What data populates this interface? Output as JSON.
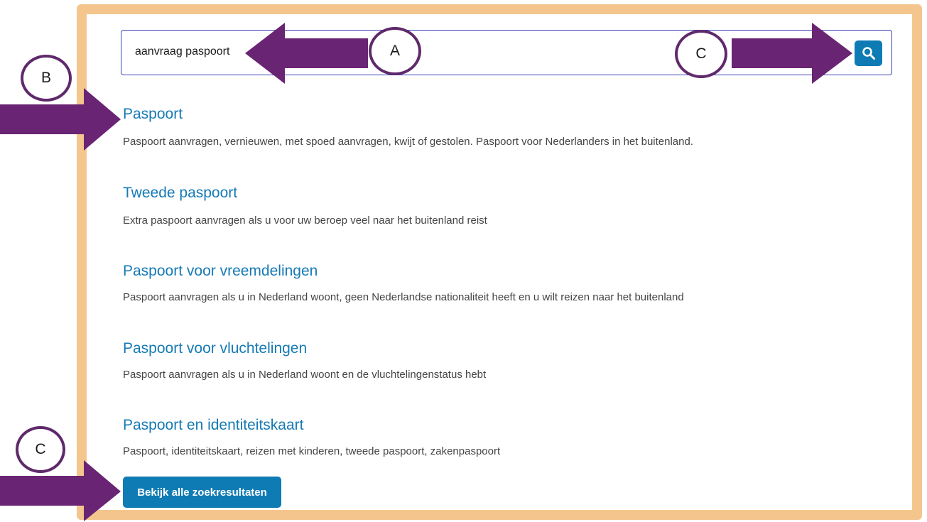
{
  "search": {
    "value": "aanvraag paspoort",
    "button_icon": "search-icon"
  },
  "results": [
    {
      "title": "Paspoort",
      "description": "Paspoort aanvragen, vernieuwen, met spoed aanvragen, kwijt of gestolen. Paspoort voor Nederlanders in het buitenland."
    },
    {
      "title": "Tweede paspoort",
      "description": "Extra paspoort aanvragen als u voor uw beroep veel naar het buitenland reist"
    },
    {
      "title": "Paspoort voor vreemdelingen",
      "description": "Paspoort aanvragen als u in Nederland woont, geen Nederlandse nationaliteit heeft en u wilt reizen naar het buitenland"
    },
    {
      "title": "Paspoort voor vluchtelingen",
      "description": "Paspoort aanvragen als u in Nederland woont en de vluchtelingenstatus hebt"
    },
    {
      "title": "Paspoort en identiteitskaart",
      "description": "Paspoort, identiteitskaart, reizen met kinderen, tweede paspoort, zakenpaspoort"
    }
  ],
  "all_results_button": {
    "label": "Bekijk alle zoekresultaten"
  },
  "annotations": {
    "a": "A",
    "b": "B",
    "c_top": "C",
    "c_bottom": "C"
  },
  "colors": {
    "frame": "#f4c68e",
    "accent": "#0f7bb4",
    "link": "#167ab5",
    "arrow": "#6a2474",
    "badge_border": "#5f2a6b"
  }
}
